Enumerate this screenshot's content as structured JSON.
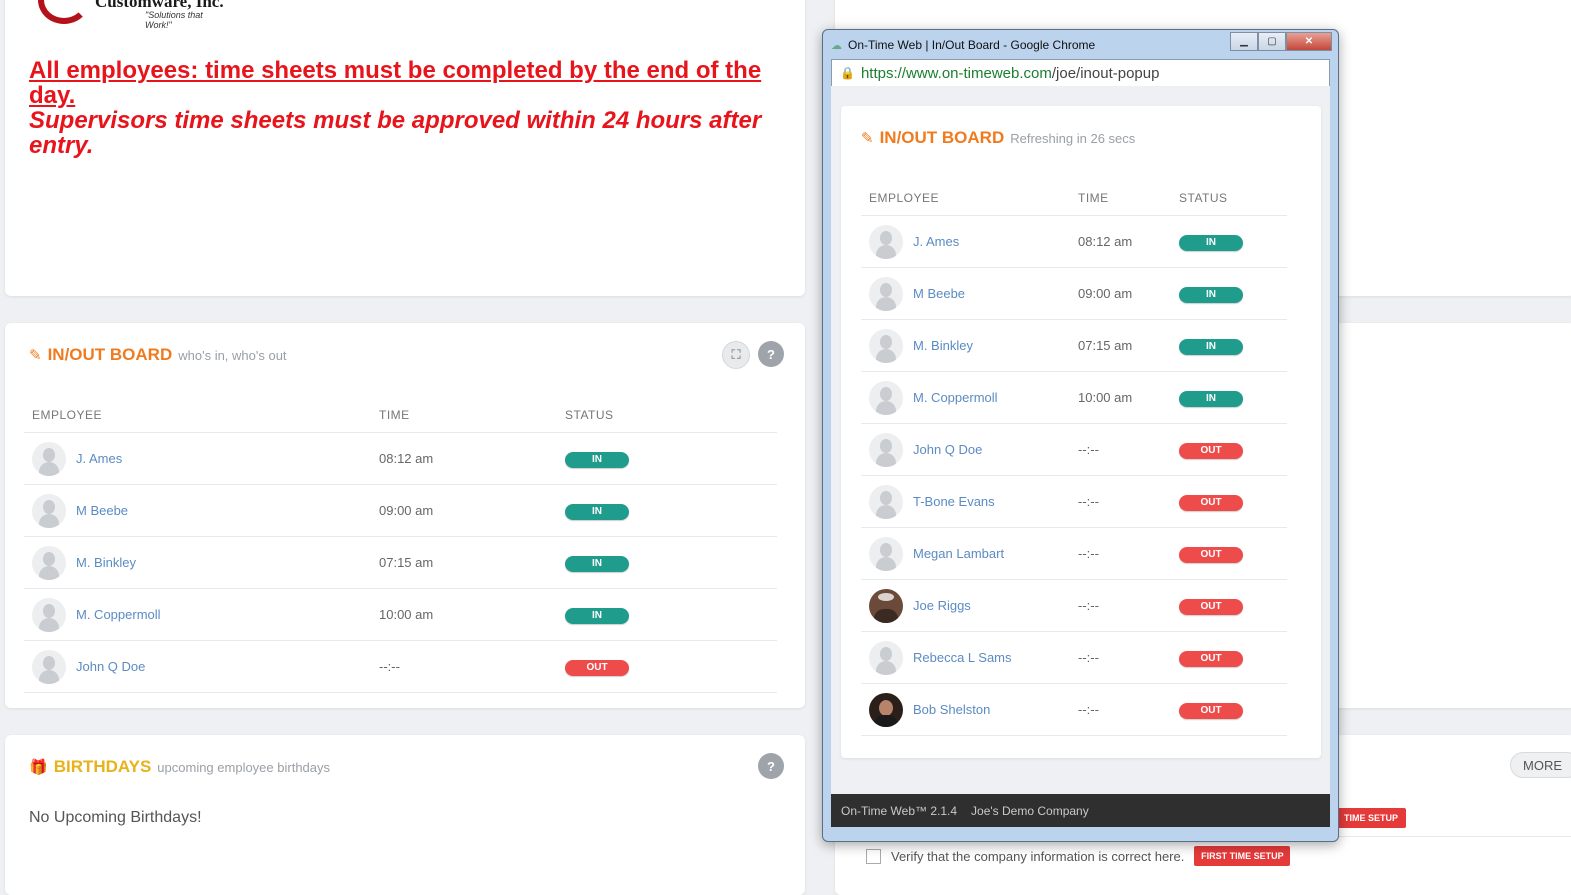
{
  "company": {
    "name": "Customware, Inc.",
    "tagline": "\"Solutions that Work!\""
  },
  "announcement": {
    "line1": "All employees: time sheets must be completed by the end of the day.",
    "line2": "Supervisors time sheets must be approved within 24 hours after entry."
  },
  "inout_board": {
    "title": "IN/OUT BOARD",
    "subtitle": "who's in, who's out",
    "expand_icon": "expand-icon",
    "help_label": "?",
    "headers": {
      "employee": "EMPLOYEE",
      "time": "TIME",
      "status": "STATUS"
    },
    "rows": [
      {
        "name": "J. Ames",
        "time": "08:12 am",
        "status": "IN"
      },
      {
        "name": "M Beebe",
        "time": "09:00 am",
        "status": "IN"
      },
      {
        "name": "M. Binkley",
        "time": "07:15 am",
        "status": "IN"
      },
      {
        "name": "M. Coppermoll",
        "time": "10:00 am",
        "status": "IN"
      },
      {
        "name": "John Q Doe",
        "time": "--:--",
        "status": "OUT"
      }
    ]
  },
  "birthdays": {
    "title": "BIRTHDAYS",
    "subtitle": "upcoming employee birthdays",
    "help_label": "?",
    "empty_text": "No Upcoming Birthdays!"
  },
  "right_panel": {
    "more_label": "MORE",
    "setup_label": "TIME SETUP",
    "verify_text": "Verify that the company information is correct here.",
    "verify_button": "FIRST TIME SETUP"
  },
  "popup": {
    "window_title": "On-Time Web | In/Out Board - Google Chrome",
    "url_host": "https://www.on-timeweb.com",
    "url_path": "/joe/inout-popup",
    "board_title": "IN/OUT BOARD",
    "refresh_text": "Refreshing in 26 secs",
    "headers": {
      "employee": "EMPLOYEE",
      "time": "TIME",
      "status": "STATUS"
    },
    "rows": [
      {
        "name": "J. Ames",
        "time": "08:12 am",
        "status": "IN",
        "avatar": "default"
      },
      {
        "name": "M Beebe",
        "time": "09:00 am",
        "status": "IN",
        "avatar": "default"
      },
      {
        "name": "M. Binkley",
        "time": "07:15 am",
        "status": "IN",
        "avatar": "default"
      },
      {
        "name": "M. Coppermoll",
        "time": "10:00 am",
        "status": "IN",
        "avatar": "default"
      },
      {
        "name": "John Q Doe",
        "time": "--:--",
        "status": "OUT",
        "avatar": "default"
      },
      {
        "name": "T-Bone Evans",
        "time": "--:--",
        "status": "OUT",
        "avatar": "default"
      },
      {
        "name": "Megan Lambart",
        "time": "--:--",
        "status": "OUT",
        "avatar": "default"
      },
      {
        "name": "Joe Riggs",
        "time": "--:--",
        "status": "OUT",
        "avatar": "photo1"
      },
      {
        "name": "Rebecca L Sams",
        "time": "--:--",
        "status": "OUT",
        "avatar": "default"
      },
      {
        "name": "Bob Shelston",
        "time": "--:--",
        "status": "OUT",
        "avatar": "photo2"
      }
    ],
    "footer_version": "On-Time Web™ 2.1.4",
    "footer_company": "Joe's Demo Company"
  },
  "colors": {
    "accent_orange": "#f07b1e",
    "status_in": "#1f9c8c",
    "status_out": "#ee4b4b",
    "alert_red": "#e8141c",
    "link_blue": "#5b8bc2"
  }
}
